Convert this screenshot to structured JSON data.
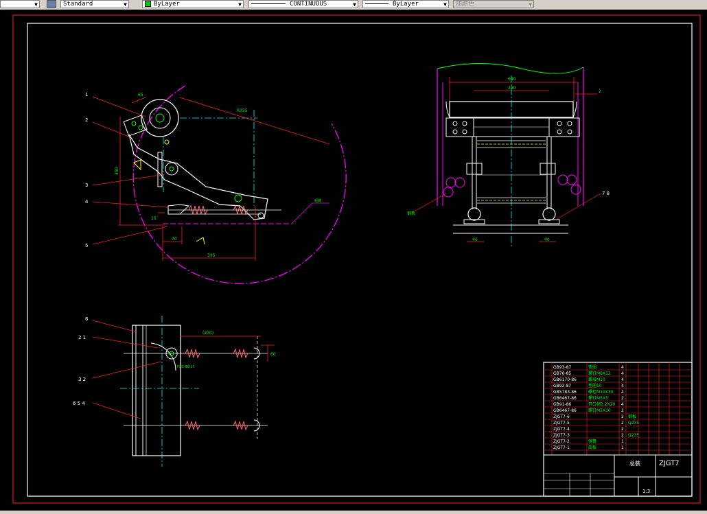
{
  "toolbar": {
    "text_style": "Standard",
    "layer": "ByLayer",
    "linetype": "CONTINUOUS",
    "lineweight": "ByLayer",
    "plotstyle": "随颜色",
    "layer_color": "#00d000"
  },
  "drawing": {
    "side_view": {
      "part_labels": [
        "1",
        "2",
        "3",
        "4",
        "5"
      ],
      "dims": {
        "d1": "65",
        "radius": "R355",
        "height": "350",
        "h2": "15",
        "w70": "70",
        "w335": "335",
        "note": "组装"
      }
    },
    "front_view": {
      "dims": {
        "w640": "640",
        "w280": "280",
        "gap": "2",
        "left40": "40",
        "right40": "40"
      },
      "labels": {
        "left": "钢轨",
        "right": "7 8"
      }
    },
    "top_view": {
      "labels": [
        "6",
        "2 1",
        "3 2",
        "6 5 4"
      ],
      "dims": {
        "top": "(200)",
        "right": "60",
        "note": "FX0.86/17"
      }
    },
    "title_block": {
      "drawing_no": "ZJGT7",
      "name": "总装",
      "scale": "1:3",
      "parts": [
        {
          "code": "GB93-87",
          "name": "垫圈",
          "qty": "4",
          "mat": ""
        },
        {
          "code": "GB70-85",
          "name": "螺钉M6X12",
          "qty": "4",
          "mat": ""
        },
        {
          "code": "GB6170-86",
          "name": "螺母M10",
          "qty": "4",
          "mat": ""
        },
        {
          "code": "GB93-87",
          "name": "垫圈10",
          "qty": "4",
          "mat": ""
        },
        {
          "code": "GB5783-86",
          "name": "螺栓M10X30",
          "qty": "4",
          "mat": ""
        },
        {
          "code": "GB6467-86",
          "name": "螺钉M5X5",
          "qty": "2",
          "mat": ""
        },
        {
          "code": "GB91-86",
          "name": "开口销3.2X20",
          "qty": "4",
          "mat": ""
        },
        {
          "code": "GB6467-86",
          "name": "螺钉M5X30",
          "qty": "2",
          "mat": ""
        },
        {
          "code": "ZJGT7-6",
          "name": "",
          "qty": "2",
          "mat": "钢板"
        },
        {
          "code": "ZJGT7-5",
          "name": "",
          "qty": "2",
          "mat": "Q235"
        },
        {
          "code": "ZJGT7-4",
          "name": "",
          "qty": "2",
          "mat": ""
        },
        {
          "code": "ZJGT7-3",
          "name": "",
          "qty": "2",
          "mat": "Q235"
        },
        {
          "code": "ZJGT7-2",
          "name": "弹簧",
          "qty": "1",
          "mat": ""
        },
        {
          "code": "ZJGT7-1",
          "name": "底板",
          "qty": "1",
          "mat": ""
        }
      ]
    }
  }
}
